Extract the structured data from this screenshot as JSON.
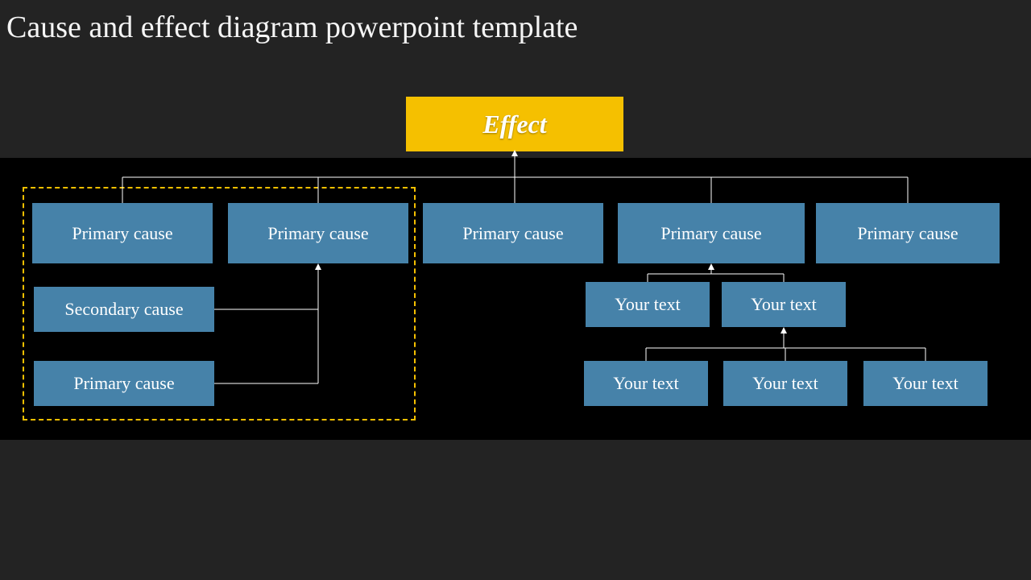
{
  "title": "Cause and effect diagram powerpoint template",
  "effect": {
    "label": "Effect"
  },
  "primary": {
    "p1": "Primary cause",
    "p2": "Primary cause",
    "p3": "Primary cause",
    "p4": "Primary cause",
    "p5": "Primary cause"
  },
  "left": {
    "secondary": "Secondary cause",
    "tertiary": "Primary cause"
  },
  "right": {
    "s1": "Your text",
    "s2": "Your text",
    "t1": "Your text",
    "t2": "Your text",
    "t3": "Your text"
  },
  "colors": {
    "accent": "#f5c000",
    "node": "#4682a9",
    "bg": "#232323",
    "stage": "#000000"
  }
}
